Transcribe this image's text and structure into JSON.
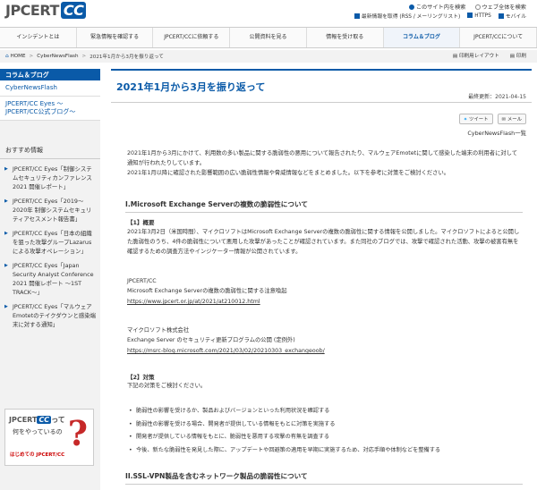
{
  "header": {
    "logo_text": "JPCERT",
    "logo_badge": "CC",
    "search_site": "このサイト内を検索",
    "search_web": "ウェブ全体を検索",
    "rss_link": "最新情報を取得 (RSS / メーリングリスト)",
    "https_link": "HTTPS",
    "mobile_link": "モバイル"
  },
  "nav": {
    "items": [
      "インシデントとは",
      "緊急情報を確認する",
      "JPCERT/CCに依頼する",
      "公開資料を見る",
      "情報を受け取る",
      "コラム＆ブログ",
      "JPCERT/CCについて"
    ]
  },
  "breadcrumb": {
    "home": "HOME",
    "level1": "CyberNewsFlash",
    "current": "2021年1月から3月を振り返って",
    "print_layout": "印刷用レイアウト",
    "print": "印刷"
  },
  "sidebar": {
    "heading": "コラム＆ブログ",
    "links": [
      "CyberNewsFlash",
      "JPCERT/CC Eyes ～JPCERT/CC公式ブログ～"
    ],
    "recommended_heading": "おすすめ情報",
    "recommended": [
      "JPCERT/CC Eyes「制御システムセキュリティカンファレンス 2021 開催レポート」",
      "JPCERT/CC Eyes「2019～2020年 制御システムセキュリティアセスメント報告書」",
      "JPCERT/CC Eyes「日本の組織を狙った攻撃グループLazarusによる攻撃オペレーション」",
      "JPCERT/CC Eyes「Japan Security Analyst Conference 2021 開催レポート ～1ST TRACK～」",
      "JPCERT/CC Eyes「マルウェアEmotetのテイクダウンと感染端末に対する通知」"
    ],
    "banner": {
      "logo": "JPCERT",
      "badge": "CC",
      "suffix": "って",
      "line2": "何をやっているの",
      "sub": "はじめての JPCERT/CC",
      "mark": "?"
    }
  },
  "main": {
    "title": "2021年1月から3月を振り返って",
    "updated": "最終更新：2021-04-15",
    "tweet": "ツイート",
    "mail": "メール",
    "list_link": "CyberNewsFlash一覧",
    "intro_1": "2021年1月から3月にかけて、利用数の多い製品に関する脆弱性の悪用について報告されたり、マルウェアEmotetに関して感染した端末の利用者に対して通知が行われたりしています。",
    "intro_2": "2021年1月以降に確認された影響範囲の広い脆弱性情報や脅威情報などをまとめました。以下を参考に対策をご検討ください。",
    "section1_title": "I.Microsoft Exchange Serverの複数の脆弱性について",
    "s1_h1": "【1】概要",
    "s1_p1": "2021年3月2日（米国時間）、マイクロソフトはMicrosoft Exchange Serverの複数の脆弱性に関する情報を公開しました。マイクロソフトによると公開した脆弱性のうち、4件の脆弱性について悪用した攻撃があったことが確認されています。また同社のブログでは、攻撃で確認された活動、攻撃の被害有無を確認するための調査方法やインジケーター情報が公開されています。",
    "ref1_org": "JPCERT/CC",
    "ref1_title": "Microsoft Exchange Serverの複数の脆弱性に関する注意喚起",
    "ref1_url": "https://www.jpcert.or.jp/at/2021/at210012.html",
    "ref2_org": "マイクロソフト株式会社",
    "ref2_title": "Exchange Server のセキュリティ更新プログラムの公開 (定例外)",
    "ref2_url": "https://msrc-blog.microsoft.com/2021/03/02/20210303_exchangeoob/",
    "s1_h2": "【2】対策",
    "s1_p2": "下記の対策をご検討ください。",
    "bullets": [
      "脆弱性の影響を受けるか、製品およびバージョンといった利用状況を確認する",
      "脆弱性の影響を受ける場合、開発者が提供している情報をもとに対策を実施する",
      "開発者が提供している情報をもとに、脆弱性を悪用する攻撃の有無を調査する",
      "今後、新たな脆弱性を発見した際に、アップデートや回避策の適用を早期に実施するため、対応手順や体制などを整備する"
    ],
    "section2_title": "II.SSL-VPN製品を含むネットワーク製品の脆弱性について"
  },
  "colors": {
    "brand_blue": "#0a5aa8",
    "banner_red": "#c62828"
  }
}
